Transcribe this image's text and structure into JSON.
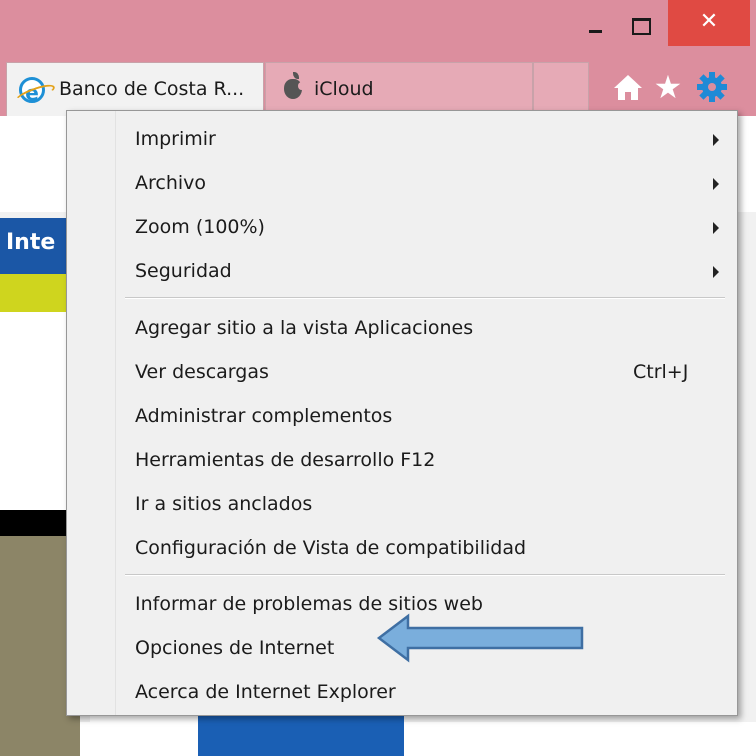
{
  "window": {
    "minimize_label": "–",
    "maximize_label": "□",
    "close_label": "✕"
  },
  "tabs": [
    {
      "label": "Banco de Costa R...",
      "icon": "ie-icon"
    },
    {
      "label": "iCloud",
      "icon": "apple-icon"
    }
  ],
  "toolbar": {
    "icons": [
      "home-icon",
      "star-icon",
      "gear-icon"
    ],
    "star_glyph": "★"
  },
  "page": {
    "visible_text": "Inte"
  },
  "menu": {
    "group1": [
      {
        "label": "Imprimir",
        "submenu": true
      },
      {
        "label": "Archivo",
        "submenu": true
      },
      {
        "label": "Zoom (100%)",
        "submenu": true
      },
      {
        "label": "Seguridad",
        "submenu": true
      }
    ],
    "group2": [
      {
        "label": "Agregar sitio a la vista Aplicaciones"
      },
      {
        "label": "Ver descargas",
        "shortcut": "Ctrl+J"
      },
      {
        "label": "Administrar complementos"
      },
      {
        "label": "Herramientas de desarrollo F12"
      },
      {
        "label": "Ir a sitios anclados"
      },
      {
        "label": "Configuración de Vista de compatibilidad"
      }
    ],
    "group3": [
      {
        "label": "Informar de problemas de sitios web"
      },
      {
        "label": "Opciones de Internet"
      },
      {
        "label": "Acerca de Internet Explorer"
      }
    ]
  },
  "colors": {
    "titlebar": "#dc8e9e",
    "close_button": "#e04a43",
    "arrow_fill": "#7aaedc",
    "arrow_stroke": "#3f6fa3",
    "gear": "#1e8ad6"
  }
}
